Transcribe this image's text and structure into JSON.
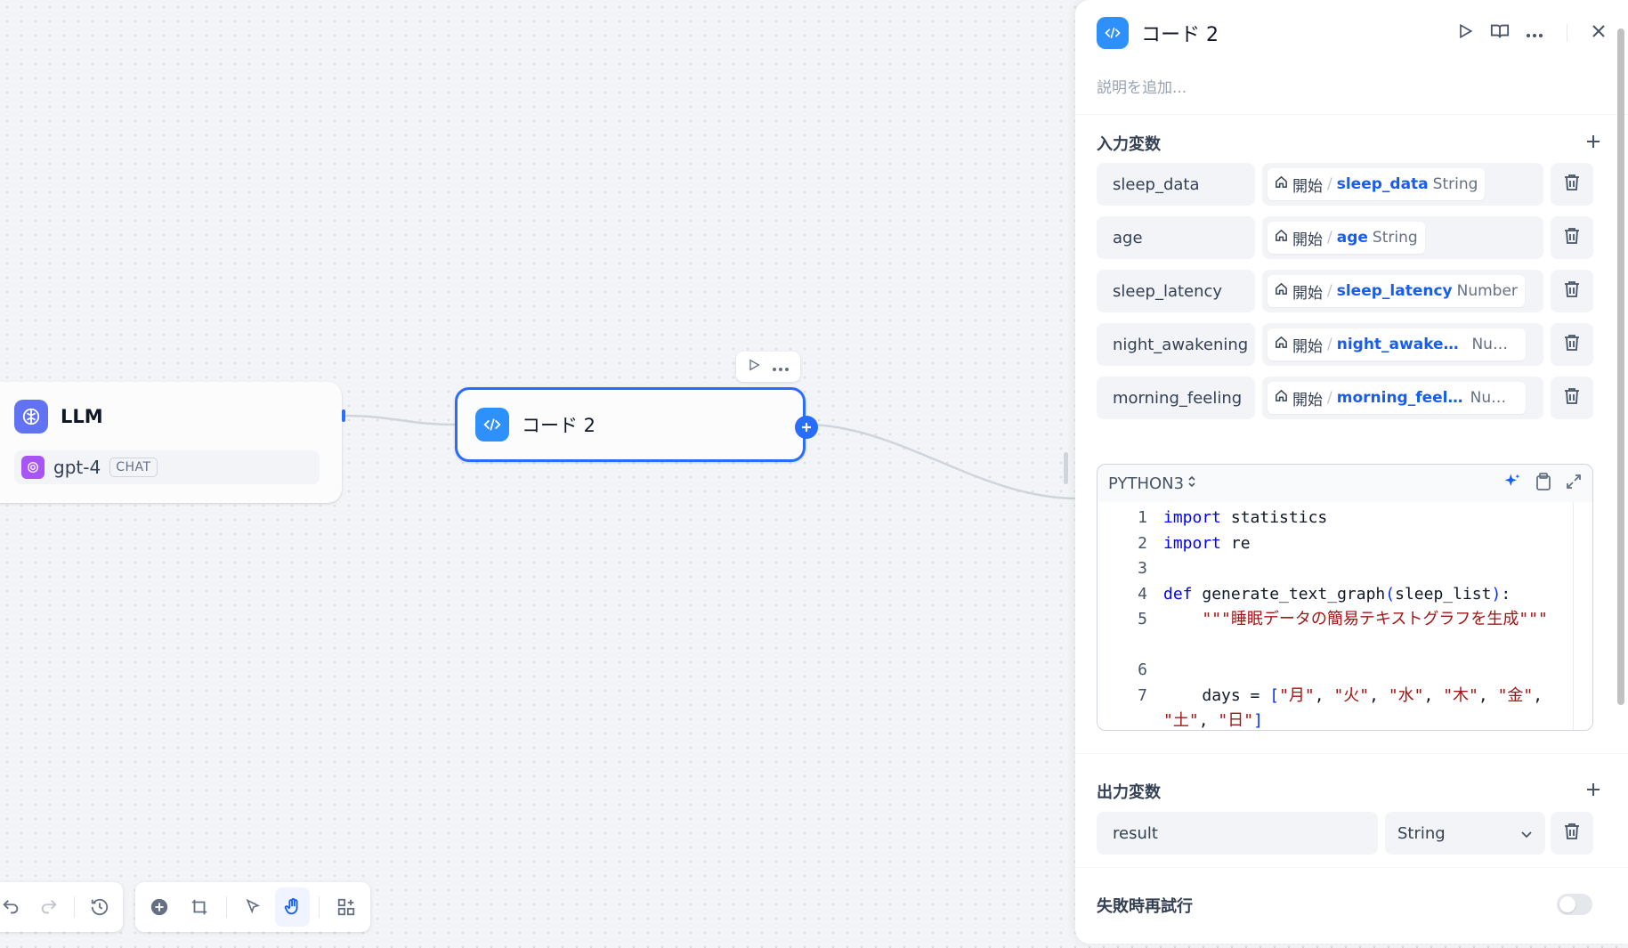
{
  "canvas": {
    "llm_node": {
      "title": "LLM",
      "model_name": "gpt-4",
      "model_mode": "CHAT"
    },
    "code_node": {
      "title": "コード 2"
    }
  },
  "panel": {
    "title": "コード 2",
    "description_placeholder": "説明を追加...",
    "input_section_title": "入力変数",
    "inputs": [
      {
        "name": "sleep_data",
        "source_node": "開始",
        "variable": "sleep_data",
        "type": "String"
      },
      {
        "name": "age",
        "source_node": "開始",
        "variable": "age",
        "type": "String"
      },
      {
        "name": "sleep_latency",
        "source_node": "開始",
        "variable": "sleep_latency",
        "type": "Number"
      },
      {
        "name": "night_awakening",
        "source_node": "開始",
        "variable": "night_awakeni...",
        "type": "Num..."
      },
      {
        "name": "morning_feeling",
        "source_node": "開始",
        "variable": "morning_feeli...",
        "type": "Num..."
      }
    ],
    "code_language": "PYTHON3",
    "code_lines": [
      {
        "n": "1",
        "tokens": [
          [
            "kw",
            "import"
          ],
          [
            "t",
            " statistics"
          ]
        ]
      },
      {
        "n": "2",
        "tokens": [
          [
            "kw",
            "import"
          ],
          [
            "t",
            " re"
          ]
        ]
      },
      {
        "n": "3",
        "tokens": []
      },
      {
        "n": "4",
        "tokens": [
          [
            "kw",
            "def"
          ],
          [
            "t",
            " generate_text_graph"
          ],
          [
            "br",
            "("
          ],
          [
            "t",
            "sleep_list"
          ],
          [
            "br",
            ")"
          ],
          [
            "t",
            ":"
          ]
        ]
      },
      {
        "n": "5",
        "tokens": [
          [
            "t",
            "    "
          ],
          [
            "str",
            "\"\"\"睡眠データの簡易テキストグラフを生成\"\"\""
          ]
        ]
      },
      {
        "n": "6",
        "tokens": []
      },
      {
        "n": "7",
        "tokens": [
          [
            "t",
            "    days = "
          ],
          [
            "br",
            "["
          ],
          [
            "str",
            "\"月\""
          ],
          [
            "t",
            ", "
          ],
          [
            "str",
            "\"火\""
          ],
          [
            "t",
            ", "
          ],
          [
            "str",
            "\"水\""
          ],
          [
            "t",
            ", "
          ],
          [
            "str",
            "\"木\""
          ],
          [
            "t",
            ", "
          ],
          [
            "str",
            "\"金\""
          ],
          [
            "t",
            ", "
          ],
          [
            "str",
            "\"土\""
          ],
          [
            "t",
            ", "
          ],
          [
            "str",
            "\"日\""
          ],
          [
            "br",
            "]"
          ]
        ]
      }
    ],
    "output_section_title": "出力変数",
    "outputs": [
      {
        "name": "result",
        "type": "String"
      }
    ],
    "retry_label": "失敗時再試行",
    "retry_enabled": false
  },
  "icons": {
    "code": "code-brackets-icon",
    "llm": "brain-icon",
    "start": "home-icon"
  },
  "colors": {
    "accent": "#296dff",
    "code_node_icon": "#2e90fa",
    "llm_node_icon": "#6172f3"
  }
}
